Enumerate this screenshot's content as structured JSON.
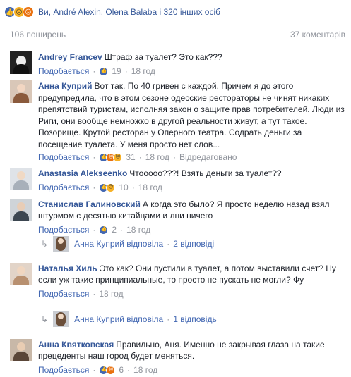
{
  "reactions": {
    "icons": [
      "like-icon",
      "sad-icon",
      "angry-icon"
    ],
    "text": "Ви, André Alexin, Olena Balaba і 320 інших осіб"
  },
  "stats": {
    "shares": "106 поширень",
    "comments": "37 коментарів"
  },
  "comments": [
    {
      "author": "Andrey Francev",
      "text": "Штраф за туалет? Это как???",
      "like_label": "Подобається",
      "reaction_count": "19",
      "time": "18 год",
      "edited": ""
    },
    {
      "author": "Анна Куприй",
      "text": "Вот так. По 40 гривен с каждой. Причем я до этого предупредила, что в этом сезоне одесские рестораторы не чинят никаких препятствий туристам, исполняя закон о защите прав потребителей. Люди из Риги, они вообще немножко в другой реальности живут, а тут такое. Позорище. Крутой ресторан у Оперного театра. Содрать деньги за посещение туалета. У меня просто нет слов...",
      "like_label": "Подобається",
      "reaction_count": "31",
      "time": "18 год",
      "edited": "Відредаговано"
    },
    {
      "author": "Anastasia Alekseenko",
      "text": "Чтооооо???! Взять деньги за туалет??",
      "like_label": "Подобається",
      "reaction_count": "10",
      "time": "18 год",
      "edited": ""
    },
    {
      "author": "Станислав Галиновский",
      "text": "А когда это было? Я просто неделю назад взял штурмом с десятью китайцами и лни ничего",
      "like_label": "Подобається",
      "reaction_count": "2",
      "time": "18 год",
      "edited": ""
    },
    {
      "author": "Наталья Хиль",
      "text": "Это как? Они пустили в туалет, а потом выставили счет? Ну если уж такие принципиальные, то просто не пускать не могли? Фу",
      "like_label": "Подобається",
      "reaction_count": "",
      "time": "18 год",
      "edited": ""
    },
    {
      "author": "Анна Квятковская",
      "text": "Правильно, Аня. Именно не закрывая глаза на такие прецеденты наш город будет меняться.",
      "like_label": "Подобається",
      "reaction_count": "6",
      "time": "18 год",
      "edited": ""
    }
  ],
  "replies": [
    {
      "author": "Анна Куприй",
      "action": "відповіла",
      "count": "2 відповіді"
    },
    {
      "author": "Анна Куприй",
      "action": "відповіла",
      "count": "1 відповідь"
    }
  ],
  "colors": {
    "link": "#365899",
    "meta": "#90949c",
    "like_blue": "#4267b2"
  }
}
